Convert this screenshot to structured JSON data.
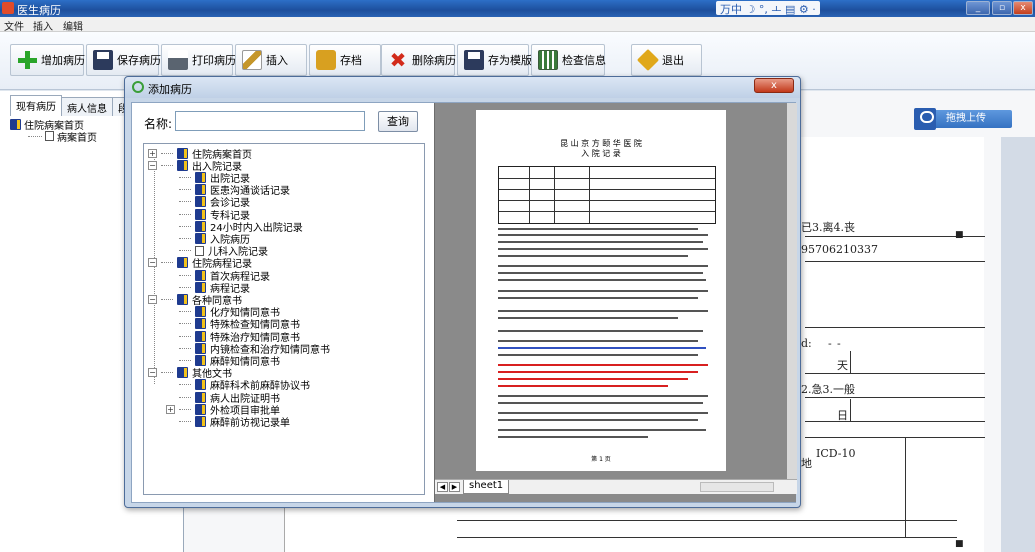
{
  "window": {
    "title": "医生病历",
    "ime_text": "万中 ☽ °, ㅗ ▤ ⚙ ·"
  },
  "menu": [
    "文件",
    "插入",
    "编辑"
  ],
  "toolbar": [
    {
      "label": "增加病历",
      "icon": "plus-icon",
      "color": "#2aa52a"
    },
    {
      "label": "保存病历",
      "icon": "save-icon",
      "color": "#2c3a5c"
    },
    {
      "label": "打印病历",
      "icon": "printer-icon",
      "color": "#5a6470"
    },
    {
      "label": "插入",
      "icon": "pencil-icon",
      "color": "#c5962a"
    },
    {
      "label": "存档",
      "icon": "archive-icon",
      "color": "#d8a020"
    },
    {
      "label": "删除病历",
      "icon": "delete-x-icon",
      "color": "#d22a1a"
    },
    {
      "label": "存为模版",
      "icon": "template-save-icon",
      "color": "#2c3a5c"
    },
    {
      "label": "检查信息",
      "icon": "check-info-icon",
      "color": "#3a7a3a"
    },
    {
      "label": "退出",
      "icon": "exit-icon",
      "color": "#e0a81a"
    }
  ],
  "left_panel": {
    "tabs": [
      "现有病历",
      "病人信息",
      "段"
    ],
    "tree": [
      {
        "label": "住院病案首页",
        "icon": "book-icon",
        "level": 0
      },
      {
        "label": "病案首页",
        "icon": "document-icon",
        "level": 1
      }
    ]
  },
  "right_area": {
    "upload_label": "拖拽上传",
    "fragments": [
      "已3.离4.丧",
      "95706210337",
      "-",
      "-",
      "天",
      "2.急3.一般",
      "日",
      "ICD-10",
      "地",
      "d:"
    ]
  },
  "dialog": {
    "title": "添加病历",
    "close_label": "x",
    "name_label": "名称:",
    "name_value": "",
    "query_label": "查询",
    "tree": [
      {
        "label": "住院病案首页",
        "level": 0,
        "toggle": "+"
      },
      {
        "label": "出入院记录",
        "level": 0,
        "toggle": "-"
      },
      {
        "label": "出院记录",
        "level": 1
      },
      {
        "label": "医患沟通谈话记录",
        "level": 1
      },
      {
        "label": "会诊记录",
        "level": 1
      },
      {
        "label": "专科记录",
        "level": 1
      },
      {
        "label": "24小时内入出院记录",
        "level": 1
      },
      {
        "label": "入院病历",
        "level": 1
      },
      {
        "label": "儿科入院记录",
        "level": 1,
        "icon": "document"
      },
      {
        "label": "住院病程记录",
        "level": 0,
        "toggle": "-"
      },
      {
        "label": "首次病程记录",
        "level": 1
      },
      {
        "label": "病程记录",
        "level": 1
      },
      {
        "label": "各种同意书",
        "level": 0,
        "toggle": "-"
      },
      {
        "label": "化疗知情同意书",
        "level": 1
      },
      {
        "label": "特殊检查知情同意书",
        "level": 1
      },
      {
        "label": "特殊治疗知情同意书",
        "level": 1
      },
      {
        "label": "内镜检查和治疗知情同意书",
        "level": 1
      },
      {
        "label": "麻醉知情同意书",
        "level": 1
      },
      {
        "label": "其他文书",
        "level": 0,
        "toggle": "-"
      },
      {
        "label": "麻醉科术前麻醉协议书",
        "level": 1
      },
      {
        "label": "病人出院证明书",
        "level": 1
      },
      {
        "label": "外检项目审批单",
        "level": 1,
        "toggle": "+"
      },
      {
        "label": "麻醉前访视记录单",
        "level": 1
      }
    ],
    "preview": {
      "hospital": "昆 山 京 方 颐 华 医 院",
      "doc_title": "入 院 记 录",
      "page_footer": "第 1 页",
      "sheet_tab": "sheet1"
    }
  }
}
